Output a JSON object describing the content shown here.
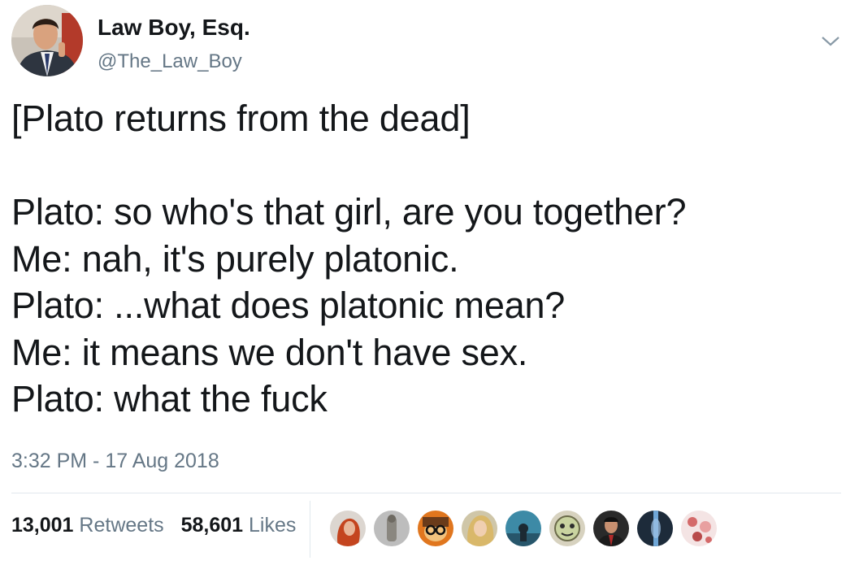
{
  "author": {
    "name": "Law Boy, Esq.",
    "handle": "@The_Law_Boy"
  },
  "tweet": {
    "lines": [
      "[Plato returns from the dead]",
      "",
      "Plato: so who's that girl, are you together?",
      "Me: nah, it's purely platonic.",
      "Plato: ...what does platonic mean?",
      "Me: it means we don't have sex.",
      "Plato: what the fuck"
    ],
    "timestamp": "3:32 PM - 17 Aug 2018"
  },
  "stats": {
    "retweets_count": "13,001",
    "retweets_label": "Retweets",
    "likes_count": "58,601",
    "likes_label": "Likes"
  },
  "liker_avatars": [
    {
      "icon": "red-hair-avatar"
    },
    {
      "icon": "grey-figure-avatar"
    },
    {
      "icon": "glasses-cartoon-avatar"
    },
    {
      "icon": "blonde-avatar"
    },
    {
      "icon": "teal-landscape-avatar"
    },
    {
      "icon": "illustrated-face-avatar"
    },
    {
      "icon": "suit-man-avatar"
    },
    {
      "icon": "dark-portrait-avatar"
    },
    {
      "icon": "pink-pattern-avatar"
    }
  ],
  "colors": {
    "text_primary": "#14171a",
    "text_secondary": "#657786",
    "divider": "#e1e8ed"
  }
}
